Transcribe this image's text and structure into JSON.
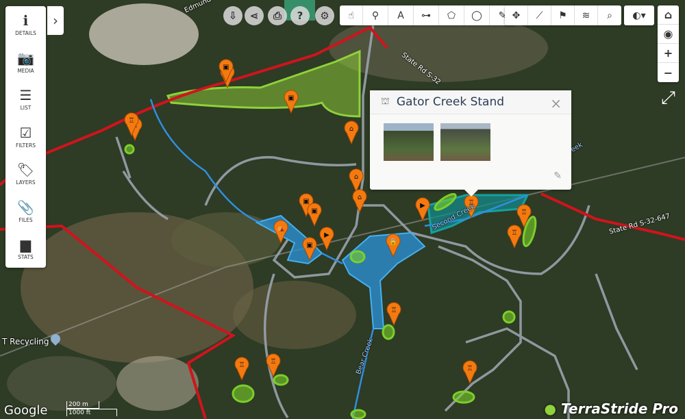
{
  "sidebar": {
    "items": [
      {
        "label": "DETAILS",
        "icon": "info-icon",
        "glyph": "ℹ"
      },
      {
        "label": "MEDIA",
        "icon": "camera-icon",
        "glyph": "📷"
      },
      {
        "label": "LIST",
        "icon": "list-icon",
        "glyph": "☰"
      },
      {
        "label": "FILTERS",
        "icon": "checkbox-icon",
        "glyph": "☑"
      },
      {
        "label": "LAYERS",
        "icon": "tags-icon",
        "glyph": "🏷"
      },
      {
        "label": "FILES",
        "icon": "paperclip-icon",
        "glyph": "📎"
      },
      {
        "label": "STATS",
        "icon": "bar-chart-icon",
        "glyph": "▆"
      }
    ],
    "expand_glyph": "›"
  },
  "top_circles": [
    {
      "icon": "mobile-download-icon",
      "glyph": "⇩"
    },
    {
      "icon": "share-icon",
      "glyph": "⋖"
    },
    {
      "icon": "print-icon",
      "glyph": "⎙"
    },
    {
      "icon": "help-icon",
      "glyph": "?"
    },
    {
      "icon": "settings-icon",
      "glyph": "⚙"
    }
  ],
  "toolbar_draw": [
    {
      "icon": "hand-pointer-icon",
      "glyph": "☝"
    },
    {
      "icon": "map-pin-icon",
      "glyph": "⚲"
    },
    {
      "icon": "text-icon",
      "glyph": "A"
    },
    {
      "icon": "line-icon",
      "glyph": "⊶"
    },
    {
      "icon": "polygon-icon",
      "glyph": "⬠"
    },
    {
      "icon": "circle-icon",
      "glyph": "◯"
    },
    {
      "icon": "pencil-icon",
      "glyph": "✎"
    }
  ],
  "toolbar_tools": [
    {
      "icon": "move-icon",
      "glyph": "✥"
    },
    {
      "icon": "ruler-icon",
      "glyph": "⟋"
    },
    {
      "icon": "map-question-icon",
      "glyph": "⚑"
    },
    {
      "icon": "layers-icon",
      "glyph": "≋"
    },
    {
      "icon": "search-icon",
      "glyph": "⌕"
    }
  ],
  "toolbar_basemap": {
    "icon": "globe-icon",
    "glyph": "◐▾"
  },
  "right_controls": {
    "home": "⌂",
    "locate": "◉",
    "zoom_in": "+",
    "zoom_out": "−",
    "fullscreen": "⤢"
  },
  "popup": {
    "title": "Gator Creek Stand",
    "icon": "tree-stand-icon",
    "close": "×",
    "edit": "✎",
    "photos": 2
  },
  "map_labels": {
    "road1": "State Rd S-32-647",
    "road2": "State Rd S-32",
    "road3": "Edmund",
    "creek1": "Second Creek",
    "creek2": "Bear Creek",
    "creek3": "eek",
    "place": "T Recycling"
  },
  "scale": {
    "metric": "200 m",
    "imperial": "1000 ft"
  },
  "attribution": "Google",
  "brand": "TerraStride Pro",
  "markers": [
    {
      "type": "video"
    },
    {
      "type": "image"
    },
    {
      "type": "image"
    },
    {
      "type": "stand"
    },
    {
      "type": "stand"
    },
    {
      "type": "house"
    },
    {
      "type": "house"
    },
    {
      "type": "house"
    },
    {
      "type": "image"
    },
    {
      "type": "image"
    },
    {
      "type": "feeder"
    },
    {
      "type": "image"
    },
    {
      "type": "video"
    },
    {
      "type": "lock"
    },
    {
      "type": "video"
    },
    {
      "type": "stand"
    },
    {
      "type": "stand"
    },
    {
      "type": "stand"
    },
    {
      "type": "stand"
    },
    {
      "type": "stand"
    },
    {
      "type": "stand"
    },
    {
      "type": "stand"
    }
  ],
  "colors": {
    "boundary": "#d0141c",
    "creek": "#2f8fe0",
    "trail": "#9aa3ad",
    "pond": "#2a8fd0",
    "food_plot": "#7ccf2a",
    "marker": "#f47a10",
    "teal_area": "#138a8a"
  }
}
